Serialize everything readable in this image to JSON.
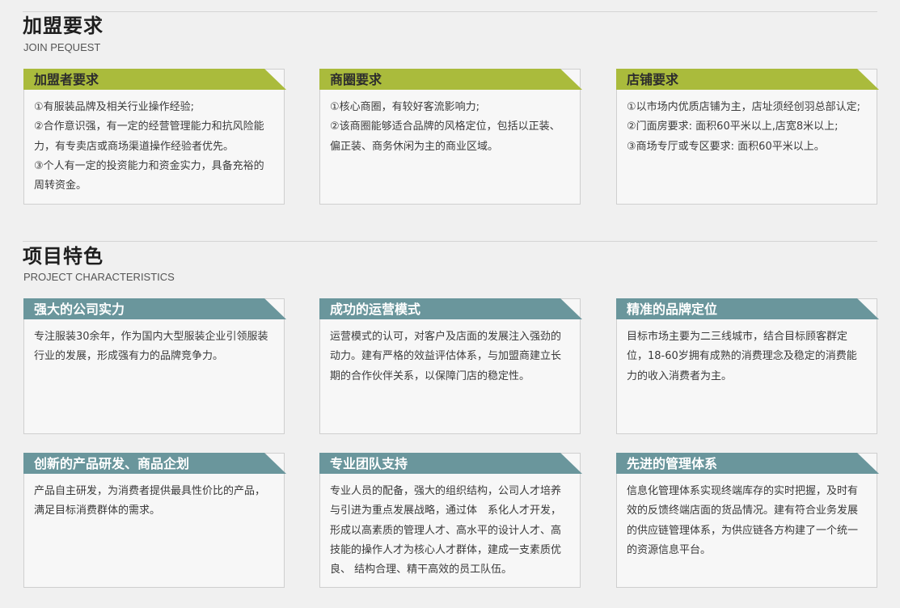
{
  "join": {
    "title": "加盟要求",
    "subtitle": "JOIN PEQUEST",
    "cards": [
      {
        "heading": "加盟者要求",
        "lines": [
          "①有服装品牌及相关行业操作经验;",
          "②合作意识强，有一定的经营管理能力和抗风险能力，有专卖店或商场渠道操作经验者优先。",
          "③个人有一定的投资能力和资金实力，具备充裕的周转资金。"
        ]
      },
      {
        "heading": "商圈要求",
        "lines": [
          "①核心商圈，有较好客流影响力;",
          "②该商圈能够适合品牌的风格定位，包括以正装、偏正装、商务休闲为主的商业区域。"
        ]
      },
      {
        "heading": "店铺要求",
        "lines": [
          "①以市场内优质店铺为主，店址须经创羽总部认定;",
          "②门面房要求: 面积60平米以上,店宽8米以上;",
          "③商场专厅或专区要求: 面积60平米以上。"
        ]
      }
    ]
  },
  "features": {
    "title": "项目特色",
    "subtitle": "PROJECT CHARACTERISTICS",
    "cards": [
      {
        "heading": "强大的公司实力",
        "text": "专注服装30余年，作为国内大型服装企业引领服装行业的发展，形成强有力的品牌竞争力。"
      },
      {
        "heading": "成功的运营模式",
        "text": "运营模式的认可，对客户及店面的发展注入强劲的动力。建有严格的效益评估体系，与加盟商建立长期的合作伙伴关系，以保障门店的稳定性。"
      },
      {
        "heading": "精准的品牌定位",
        "text": "目标市场主要为二三线城市，结合目标顾客群定位，18-60岁拥有成熟的消费理念及稳定的消费能力的收入消费者为主。"
      },
      {
        "heading": "创新的产品研发、商品企划",
        "text": "产品自主研发，为消费者提供最具性价比的产品，满足目标消费群体的需求。"
      },
      {
        "heading": "专业团队支持",
        "text": "专业人员的配备，强大的组织结构，公司人才培养与引进为重点发展战略，通过体　系化人才开发，形成以高素质的管理人才、高水平的设计人才、高技能的操作人才为核心人才群体，建成一支素质优良、 结构合理、精干高效的员工队伍。"
      },
      {
        "heading": "先进的管理体系",
        "text": "信息化管理体系实现终端库存的实时把握，及时有效的反馈终端店面的货品情况。建有符合业务发展的供应链管理体系，为供应链各方构建了一个统一的资源信息平台。"
      }
    ]
  },
  "colors": {
    "join_header": "#aabb3c",
    "feature_header": "#6a969c"
  }
}
